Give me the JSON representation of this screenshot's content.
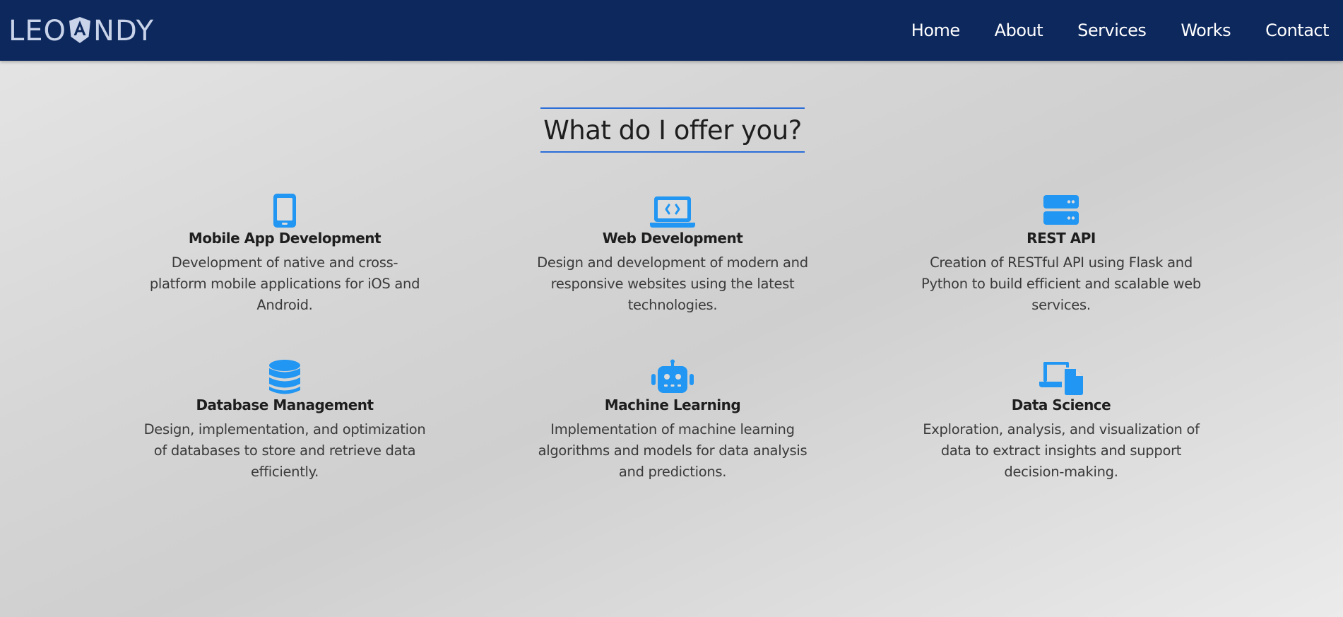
{
  "header": {
    "logo_text_left": "LEO",
    "logo_text_right": "NDY",
    "nav": [
      {
        "label": "Home"
      },
      {
        "label": "About"
      },
      {
        "label": "Services"
      },
      {
        "label": "Works"
      },
      {
        "label": "Contact"
      }
    ],
    "colors": {
      "bar": "#0d285d",
      "logo": "#c9d4ea"
    }
  },
  "section": {
    "title": "What do I offer you?",
    "accent": "#2a6dd8",
    "icon_color": "#2196f3",
    "services": [
      {
        "icon": "mobile-phone-icon",
        "title": "Mobile App Development",
        "description": "Development of native and cross-platform mobile applications for iOS and Android."
      },
      {
        "icon": "laptop-code-icon",
        "title": "Web Development",
        "description": "Design and development of modern and responsive websites using the latest technologies."
      },
      {
        "icon": "server-icon",
        "title": "REST API",
        "description": "Creation of RESTful API using Flask and Python to build efficient and scalable web services."
      },
      {
        "icon": "database-icon",
        "title": "Database Management",
        "description": "Design, implementation, and optimization of databases to store and retrieve data efficiently."
      },
      {
        "icon": "robot-icon",
        "title": "Machine Learning",
        "description": "Implementation of machine learning algorithms and models for data analysis and predictions."
      },
      {
        "icon": "laptop-file-icon",
        "title": "Data Science",
        "description": "Exploration, analysis, and visualization of data to extract insights and support decision-making."
      }
    ]
  }
}
